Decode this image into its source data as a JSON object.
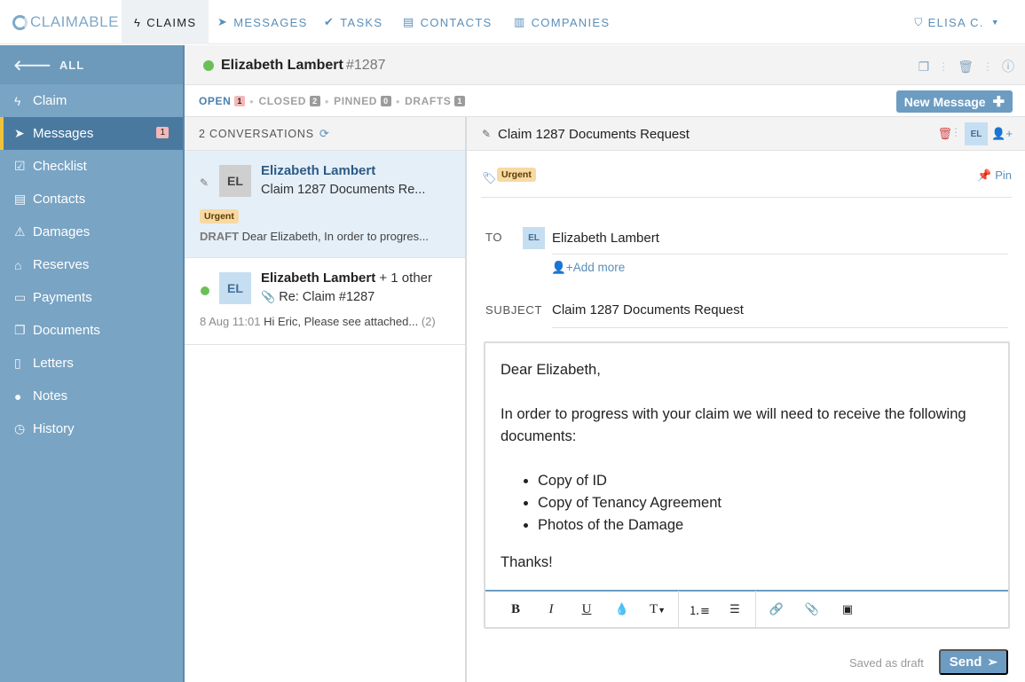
{
  "app": {
    "logo": "CLAIMABLE"
  },
  "nav": {
    "claims": "CLAIMS",
    "messages": "MESSAGES",
    "tasks": "TASKS",
    "contacts": "CONTACTS",
    "companies": "COMPANIES",
    "user": "ELISA C."
  },
  "sidebar": {
    "all": "ALL",
    "items": [
      {
        "label": "Claim",
        "icon": "bolt-icon"
      },
      {
        "label": "Messages",
        "icon": "paper-plane-icon",
        "badge": "1"
      },
      {
        "label": "Checklist",
        "icon": "checklist-icon"
      },
      {
        "label": "Contacts",
        "icon": "contact-card-icon"
      },
      {
        "label": "Damages",
        "icon": "warning-icon"
      },
      {
        "label": "Reserves",
        "icon": "bank-icon"
      },
      {
        "label": "Payments",
        "icon": "credit-card-icon"
      },
      {
        "label": "Documents",
        "icon": "documents-icon"
      },
      {
        "label": "Letters",
        "icon": "letter-icon"
      },
      {
        "label": "Notes",
        "icon": "comment-icon"
      },
      {
        "label": "History",
        "icon": "clock-icon"
      }
    ]
  },
  "claim": {
    "name": "Elizabeth Lambert",
    "number": "1287",
    "hash": "#"
  },
  "filters": {
    "open": "OPEN",
    "open_count": "1",
    "closed": "CLOSED",
    "closed_count": "2",
    "pinned": "PINNED",
    "pinned_count": "0",
    "drafts": "DRAFTS",
    "drafts_count": "1"
  },
  "new_message": "New Message",
  "conversations": {
    "header": "2 CONVERSATIONS",
    "items": [
      {
        "initials": "EL",
        "name": "Elizabeth Lambert",
        "subject": "Claim 1287 Documents Re...",
        "tag": "Urgent",
        "draft_label": "DRAFT",
        "preview": "Dear Elizabeth, In order to progres..."
      },
      {
        "initials": "EL",
        "name": "Elizabeth Lambert",
        "extra": "+ 1 other",
        "subject": "Re: Claim #1287",
        "time": "8 Aug 11:01",
        "preview": "Hi Eric, Please see attached...",
        "count": "(2)"
      }
    ]
  },
  "message": {
    "title": "Claim 1287 Documents Request",
    "header_initials": "EL",
    "tag": "Urgent",
    "pin": "Pin",
    "to_label": "TO",
    "to_initials": "EL",
    "to_name": "Elizabeth Lambert",
    "add_more": "Add more",
    "subject_label": "SUBJECT",
    "subject": "Claim 1287 Documents Request",
    "body": {
      "greeting": "Dear Elizabeth,",
      "intro": "In order to progress with your claim we will need to receive the following documents:",
      "list": [
        "Copy of ID",
        "Copy of Tenancy Agreement",
        "Photos of the Damage"
      ],
      "closing": "Thanks!"
    },
    "toolbar": {
      "bold": "B",
      "italic": "I",
      "underline": "U",
      "text_size": "T"
    },
    "saved": "Saved as draft",
    "send": "Send"
  }
}
